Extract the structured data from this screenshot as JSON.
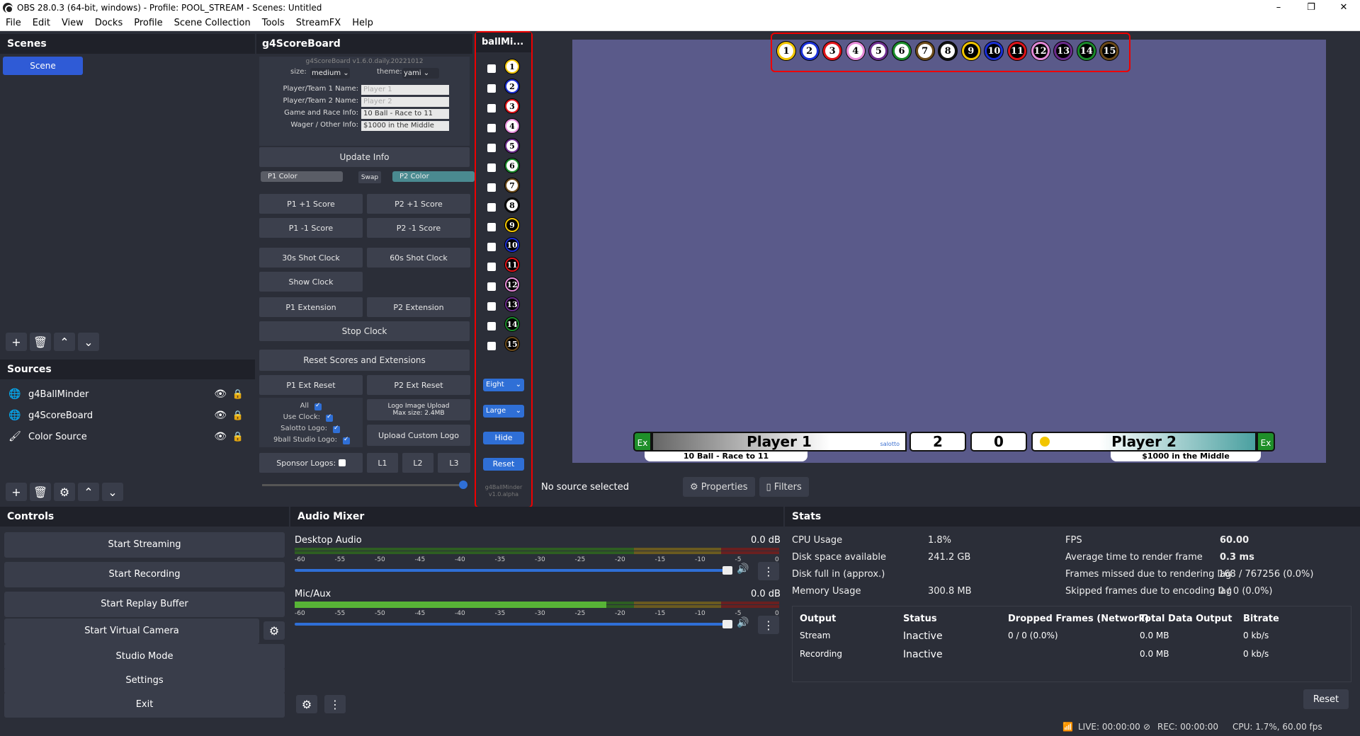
{
  "window": {
    "title": "OBS 28.0.3 (64-bit, windows) - Profile: POOL_STREAM - Scenes: Untitled",
    "controls": [
      "–",
      "❐",
      "✕"
    ]
  },
  "menu": [
    "File",
    "Edit",
    "View",
    "Docks",
    "Profile",
    "Scene Collection",
    "Tools",
    "StreamFX",
    "Help"
  ],
  "scenes": {
    "title": "Scenes",
    "items": [
      "Scene"
    ]
  },
  "sources": {
    "title": "Sources",
    "items": [
      {
        "name": "g4BallMinder",
        "icon": "globe-icon"
      },
      {
        "name": "g4ScoreBoard",
        "icon": "globe-icon"
      },
      {
        "name": "Color Source",
        "icon": "brush-icon"
      }
    ]
  },
  "scoreboard": {
    "title": "g4ScoreBoard",
    "version": "g4ScoreBoard v1.6.0.daily.20221012",
    "size_label": "size:",
    "size_value": "medium",
    "theme_label": "theme:",
    "theme_value": "yami",
    "fields": [
      {
        "label": "Player/Team 1 Name:",
        "value": "",
        "placeholder": "Player 1"
      },
      {
        "label": "Player/Team 2 Name:",
        "value": "",
        "placeholder": "Player 2"
      },
      {
        "label": "Game and Race Info:",
        "value": "10 Ball - Race to 11",
        "placeholder": ""
      },
      {
        "label": "Wager / Other Info:",
        "value": "$1000 in the Middle",
        "placeholder": ""
      }
    ],
    "update_info": "Update Info",
    "p1_color": "P1 Color",
    "swap": "Swap",
    "p2_color": "P2 Color",
    "p1_plus": "P1 +1 Score",
    "p2_plus": "P2 +1 Score",
    "p1_minus": "P1 -1 Score",
    "p2_minus": "P2 -1 Score",
    "shot30": "30s Shot Clock",
    "shot60": "60s Shot Clock",
    "show_clock": "Show Clock",
    "p1_ext": "P1 Extension",
    "p2_ext": "P2 Extension",
    "stop_clock": "Stop Clock",
    "reset_scores": "Reset Scores and Extensions",
    "p1_ext_reset": "P1 Ext Reset",
    "p2_ext_reset": "P2 Ext Reset",
    "all_label": "All",
    "use_clock": "Use Clock:",
    "salotto_logo": "Salotto Logo:",
    "nineball_logo": "9ball Studio Logo:",
    "logo_upload": "Logo Image Upload",
    "logo_max": "Max size: 2.4MB",
    "upload_custom": "Upload Custom Logo",
    "sponsor_logos": "Sponsor Logos:",
    "l1": "L1",
    "l2": "L2",
    "l3": "L3"
  },
  "ballminder": {
    "title": "ballMi...",
    "balls": [
      "1",
      "2",
      "3",
      "4",
      "5",
      "6",
      "7",
      "8",
      "9",
      "10",
      "11",
      "12",
      "13",
      "14",
      "15"
    ],
    "ball_colors": [
      "#f2c500",
      "#1a2fd6",
      "#e0141a",
      "#e58ad9",
      "#6b2b8c",
      "#1a8a2a",
      "#6b4a1a",
      "#111111",
      "#f2c500",
      "#1a2fd6",
      "#e0141a",
      "#e58ad9",
      "#6b2b8c",
      "#1a8a2a",
      "#6b4a1a"
    ],
    "game_select": "Eight",
    "size_select": "Large",
    "hide": "Hide",
    "reset": "Reset",
    "footer1": "g4BallMinder",
    "footer2": "v1.0.alpha"
  },
  "preview": {
    "player1": "Player 1",
    "player2": "Player 2",
    "score1": "2",
    "score2": "0",
    "ex": "Ex",
    "race_info": "10 Ball - Race to 11",
    "wager_info": "$1000 in the Middle",
    "logo_text": "salotto"
  },
  "context": {
    "no_source": "No source selected",
    "properties": "Properties",
    "filters": "Filters"
  },
  "controls": {
    "title": "Controls",
    "buttons": [
      "Start Streaming",
      "Start Recording",
      "Start Replay Buffer",
      "Start Virtual Camera",
      "Studio Mode",
      "Settings",
      "Exit"
    ]
  },
  "mixer": {
    "title": "Audio Mixer",
    "channels": [
      {
        "name": "Desktop Audio",
        "level": "0.0 dB"
      },
      {
        "name": "Mic/Aux",
        "level": "0.0 dB"
      }
    ],
    "scale": [
      "-60",
      "-55",
      "-50",
      "-45",
      "-40",
      "-35",
      "-30",
      "-25",
      "-20",
      "-15",
      "-10",
      "-5",
      "0"
    ]
  },
  "stats": {
    "title": "Stats",
    "left": [
      {
        "label": "CPU Usage",
        "value": "1.8%"
      },
      {
        "label": "Disk space available",
        "value": "241.2 GB"
      },
      {
        "label": "Disk full in (approx.)",
        "value": ""
      },
      {
        "label": "Memory Usage",
        "value": "300.8 MB"
      }
    ],
    "right": [
      {
        "label": "FPS",
        "value": "60.00"
      },
      {
        "label": "Average time to render frame",
        "value": "0.3 ms"
      },
      {
        "label": "Frames missed due to rendering lag",
        "value": "168 / 767256 (0.0%)"
      },
      {
        "label": "Skipped frames due to encoding lag",
        "value": "0 / 0 (0.0%)"
      }
    ],
    "table_headers": [
      "Output",
      "Status",
      "Dropped Frames (Network)",
      "Total Data Output",
      "Bitrate"
    ],
    "rows": [
      [
        "Stream",
        "Inactive",
        "0 / 0 (0.0%)",
        "0.0 MB",
        "0 kb/s"
      ],
      [
        "Recording",
        "Inactive",
        "",
        "0.0 MB",
        "0 kb/s"
      ]
    ],
    "reset": "Reset"
  },
  "statusbar": {
    "live": "LIVE: 00:00:00",
    "rec": "REC: 00:00:00",
    "cpu": "CPU: 1.7%, 60.00 fps"
  }
}
